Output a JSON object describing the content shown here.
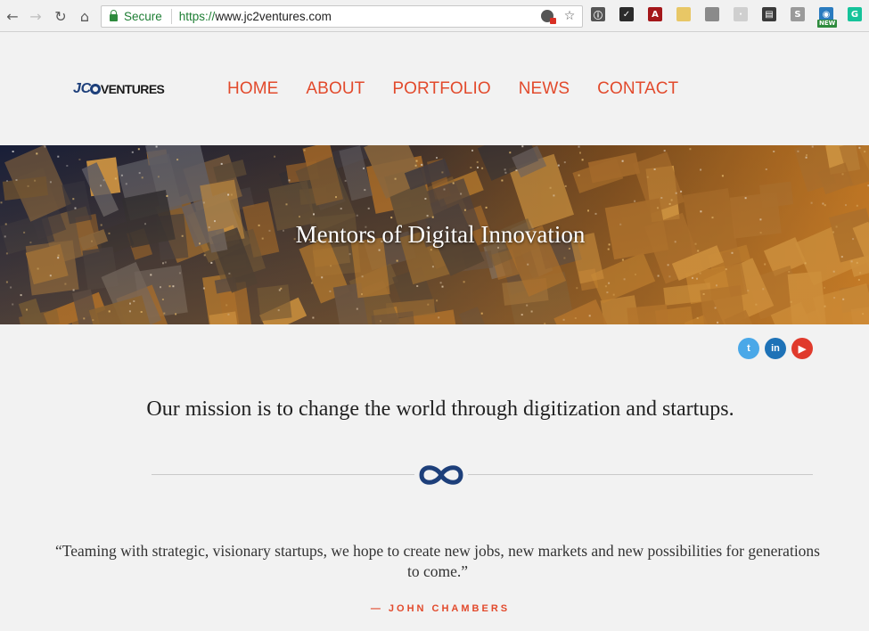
{
  "browser": {
    "secure_label": "Secure",
    "url_scheme": "https://",
    "url_host": "www.jc2ventures.com",
    "nav_icons": [
      "back-icon",
      "forward-icon",
      "reload-icon",
      "home-icon"
    ],
    "extensions": [
      {
        "name": "adblock-extension-icon",
        "color": "#555555",
        "glyph": "ⓘ"
      },
      {
        "name": "todoist-extension-icon",
        "color": "#2b2b2b",
        "glyph": "✓"
      },
      {
        "name": "acrobat-extension-icon",
        "color": "#a4171a",
        "glyph": "A"
      },
      {
        "name": "notes-extension-icon",
        "color": "#e8c766",
        "glyph": ""
      },
      {
        "name": "pocket-extension-icon",
        "color": "#8a8a8a",
        "glyph": ""
      },
      {
        "name": "dots-extension-icon",
        "color": "#cfcfcf",
        "glyph": "·"
      },
      {
        "name": "film-extension-icon",
        "color": "#3a3a3a",
        "glyph": "▤"
      },
      {
        "name": "s-extension-icon",
        "color": "#9a9a9a",
        "glyph": "S"
      },
      {
        "name": "globe-extension-icon",
        "color": "#2a7bbf",
        "glyph": "◉",
        "badge": "NEW"
      },
      {
        "name": "grammarly-extension-icon",
        "color": "#15c39a",
        "glyph": "G"
      }
    ]
  },
  "site": {
    "logo_jc": "JC",
    "logo_rest": "VENTURES",
    "nav": [
      "HOME",
      "ABOUT",
      "PORTFOLIO",
      "NEWS",
      "CONTACT"
    ],
    "accent_color": "#e24a2c"
  },
  "hero": {
    "title": "Mentors of Digital Innovation"
  },
  "social": [
    {
      "name": "twitter-icon",
      "glyph": "t",
      "color": "#4aa8e8"
    },
    {
      "name": "linkedin-icon",
      "glyph": "in",
      "color": "#1e72b7"
    },
    {
      "name": "youtube-icon",
      "glyph": "▶",
      "color": "#e03a2c"
    }
  ],
  "mission": "Our mission is to change the world through digitization and startups.",
  "quote": {
    "text": "“Teaming with strategic, visionary startups, we hope to create new jobs, new markets and new possibilities for generations to come.”",
    "attribution": "— JOHN CHAMBERS"
  }
}
